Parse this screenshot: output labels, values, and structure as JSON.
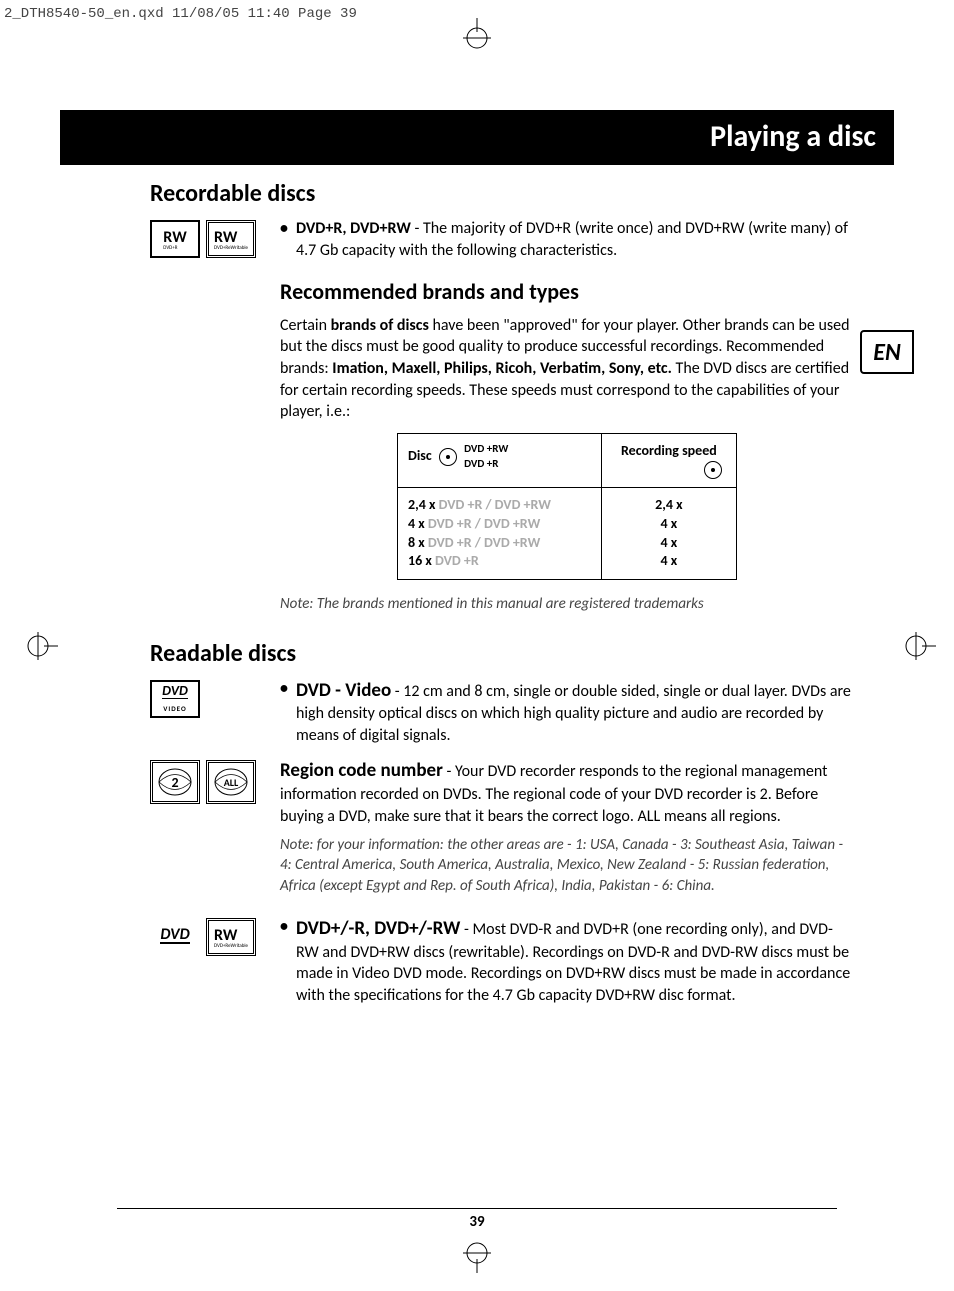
{
  "print_header": "2_DTH8540-50_en.qxd  11/08/05  11:40  Page 39",
  "title_bar": "Playing a disc",
  "lang_tab": "EN",
  "page_number": "39",
  "sections": {
    "recordable": {
      "heading": "Recordable discs",
      "bullet_lead": "DVD+R, DVD+RW",
      "bullet_text": " - The majority of DVD+R (write once) and DVD+RW (write many) of 4.7 Gb capacity with the following characteristics.",
      "subhead": "Recommended brands and types",
      "para1_a": "Certain ",
      "para1_bold1": "brands of discs",
      "para1_b": " have been \"approved\" for your player. Other brands can be used but the discs must be good quality to produce successful recordings. Recommended brands: ",
      "para1_bold2": "Imation, Maxell, Philips, Ricoh, Verbatim, Sony, etc.",
      "para1_c": " The DVD discs are certified for certain recording speeds. These speeds must correspond to the capabilities of your player, i.e.:",
      "table": {
        "h1": "Disc",
        "h1b": "DVD +RW\nDVD +R",
        "h2": "Recording speed",
        "rows": [
          {
            "label_prefix": "2,4 x ",
            "label_grey": "DVD +R / DVD +RW",
            "speed": "2,4 x"
          },
          {
            "label_prefix": "4 x ",
            "label_grey": "DVD +R / DVD +RW",
            "speed": "4 x"
          },
          {
            "label_prefix": "8 x ",
            "label_grey": "DVD +R / DVD +RW",
            "speed": "4 x"
          },
          {
            "label_prefix": "16 x ",
            "label_grey": "DVD +R",
            "speed": "4 x"
          }
        ]
      },
      "note": "Note: The brands mentioned in this manual are registered trademarks"
    },
    "readable": {
      "heading": "Readable discs",
      "dvd_video": {
        "lead": "DVD - Video",
        "text": " - 12 cm and 8 cm, single or double sided, single or dual layer. DVDs are high density optical discs on which high quality picture and audio are recorded by means of digital signals."
      },
      "region": {
        "lead": "Region code number",
        "text": " - Your DVD recorder responds to the regional management information recorded on DVDs. The regional code of your DVD recorder is 2. Before buying a DVD, make sure that it bears the correct logo. ALL means all regions.",
        "note": "Note: for your information: the other areas are - 1: USA, Canada - 3: Southeast Asia, Taiwan - 4: Central America, South America, Australia, Mexico, New Zealand - 5: Russian federation, Africa (except Egypt and Rep. of South Africa), India, Pakistan - 6: China."
      },
      "dvd_rw": {
        "lead": "DVD+/-R, DVD+/-RW",
        "text": " - Most DVD-R and DVD+R (one recording only), and DVD-RW and DVD+RW discs (rewritable). Recordings on DVD-R and DVD-RW discs must be made in Video DVD mode. Recordings on DVD+RW discs must be made in accordance with the specifications for the 4.7 Gb capacity DVD+RW disc format."
      }
    }
  },
  "chart_data": {
    "type": "table",
    "title": "Disc recording speed compatibility",
    "columns": [
      "Disc (DVD +RW / DVD +R)",
      "Recording speed"
    ],
    "rows": [
      [
        "2,4 x DVD +R / DVD +RW",
        "2,4 x"
      ],
      [
        "4 x DVD +R / DVD +RW",
        "4 x"
      ],
      [
        "8 x DVD +R / DVD +RW",
        "4 x"
      ],
      [
        "16 x DVD +R",
        "4 x"
      ]
    ]
  }
}
